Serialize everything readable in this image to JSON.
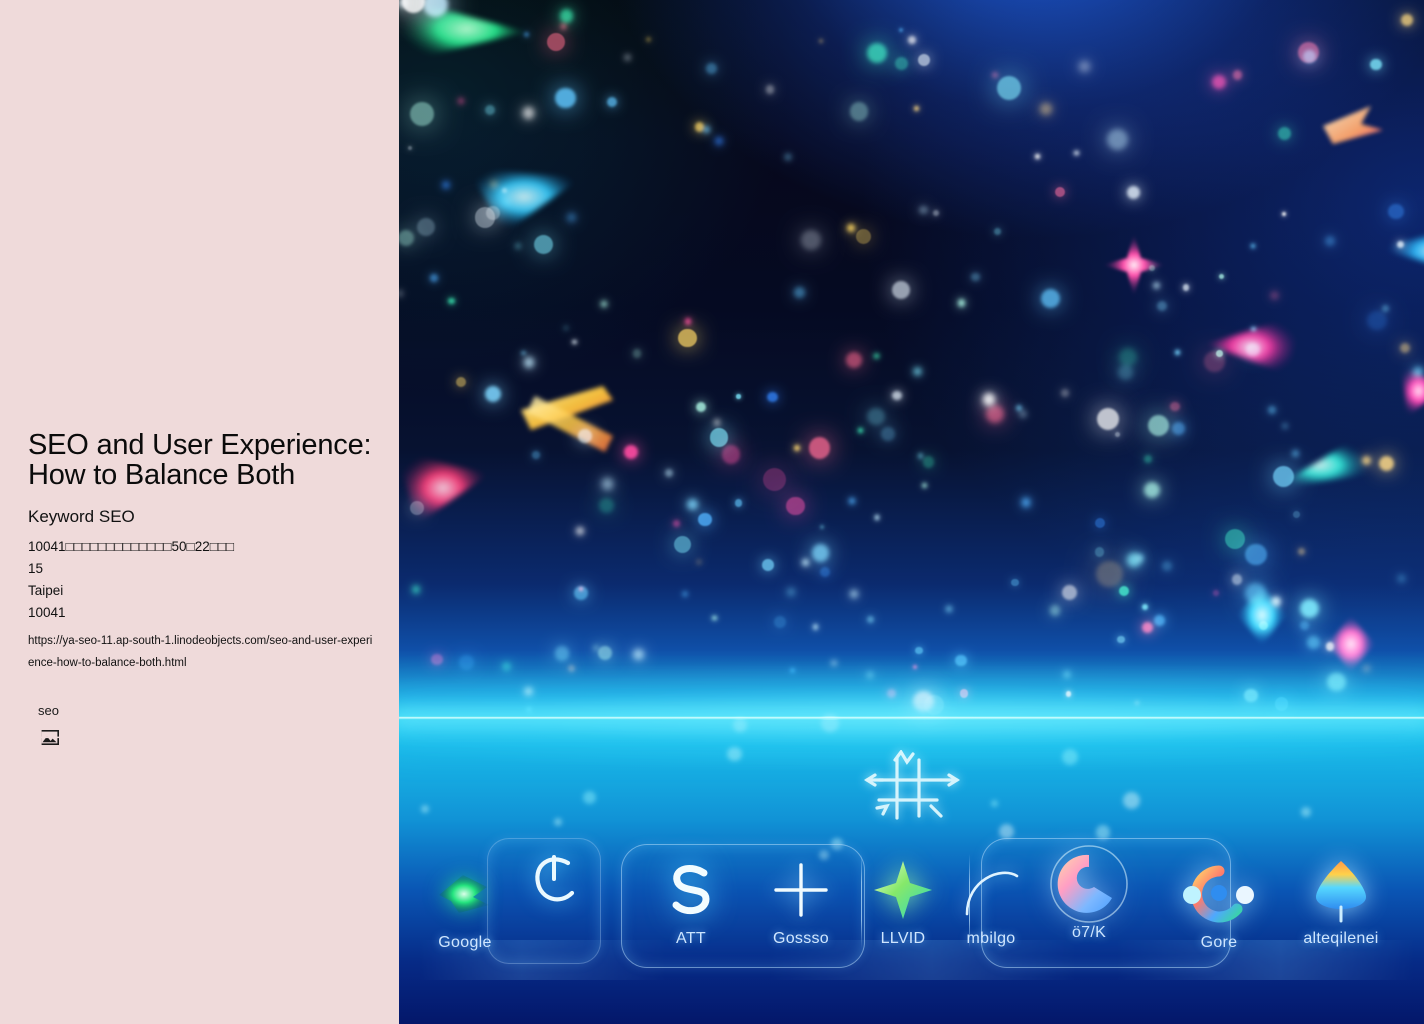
{
  "document": {
    "title": "SEO and User Experience: How to Balance Both",
    "subtitle": "Keyword SEO",
    "address_line": "10041□□□□□□□□□□□□□50□22□□□",
    "number_line": "15",
    "city": "Taipei",
    "postal_code": "10041",
    "url": "https://ya-seo-11.ap-south-1.linodeobjects.com/seo-and-user-experience-how-to-balance-both.html",
    "tag": "seo",
    "broken_image_alt": "",
    "background_color": "#efdada",
    "text_color": "#0b0b0b"
  },
  "hero": {
    "alt": "Abstract neon particle field with glowing horizon and app icon dock",
    "horizon_color": "#2fd9f2",
    "sky_top_color": "#04050e",
    "sky_glow_color": "#1a5ce6",
    "sky_bottom_color": "#04176a",
    "dock": {
      "items": [
        {
          "label": "Google",
          "icon": "green-burst-icon"
        },
        {
          "label": "",
          "icon": "neon-c-icon"
        },
        {
          "label": "ATT",
          "icon": "neon-s-icon"
        },
        {
          "label": "Gossso",
          "icon": "plus-cross-icon"
        },
        {
          "label": "LLVID",
          "icon": "green-star-icon"
        },
        {
          "label": "mbilgo",
          "icon": "arc-icon"
        },
        {
          "label": "ö7/K",
          "icon": "chrome-c-icon"
        },
        {
          "label": "Gore",
          "icon": "multicolor-orbit-icon"
        },
        {
          "label": "alteqilenei",
          "icon": "gradient-cone-icon"
        }
      ]
    },
    "center_glyph": "abstract-arrow-grid-glyph"
  }
}
